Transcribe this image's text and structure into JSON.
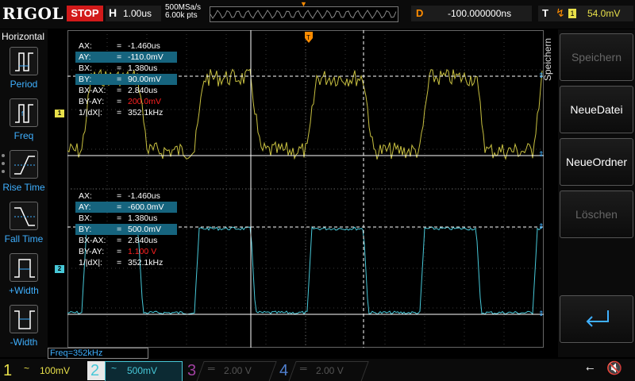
{
  "topbar": {
    "logo": "RIGOL",
    "run_state": "STOP",
    "timebase_key": "H",
    "timebase_value": "1.00us",
    "sample_rate": "500MSa/s",
    "memory_points": "6.00k pts",
    "delay_key": "D",
    "delay_value": "-100.000000ns",
    "trigger_key": "T",
    "trigger_source": "1",
    "trigger_level": "54.0mV"
  },
  "left_menu": {
    "title": "Horizontal",
    "items": [
      {
        "label": "Period",
        "icon": "period-icon"
      },
      {
        "label": "Freq",
        "icon": "freq-icon"
      },
      {
        "label": "Rise Time",
        "icon": "rise-time-icon"
      },
      {
        "label": "Fall Time",
        "icon": "fall-time-icon"
      },
      {
        "label": "+Width",
        "icon": "plus-width-icon"
      },
      {
        "label": "-Width",
        "icon": "minus-width-icon"
      }
    ]
  },
  "cursor_ch1": {
    "rows": [
      {
        "k": "AX:",
        "v": "-1.460us"
      },
      {
        "k": "AY:",
        "v": "-110.0mV"
      },
      {
        "k": "BX:",
        "v": "1.380us"
      },
      {
        "k": "BY:",
        "v": "90.00mV"
      },
      {
        "k": "BX-AX:",
        "v": "2.840us"
      },
      {
        "k": "BY-AY:",
        "v": "200.0mV"
      },
      {
        "k": "1/|dX|:",
        "v": "352.1kHz"
      }
    ]
  },
  "cursor_ch2": {
    "rows": [
      {
        "k": "AX:",
        "v": "-1.460us"
      },
      {
        "k": "AY:",
        "v": "-600.0mV"
      },
      {
        "k": "BX:",
        "v": "1.380us"
      },
      {
        "k": "BY:",
        "v": "500.0mV"
      },
      {
        "k": "BX-AX:",
        "v": "2.840us"
      },
      {
        "k": "BY-AY:",
        "v": "1.100 V"
      },
      {
        "k": "1/|dX|:",
        "v": "352.1kHz"
      }
    ]
  },
  "channel_markers": {
    "ch1": "1",
    "ch2": "2"
  },
  "freq_readout": "Freq=352kHz",
  "right_menu": {
    "vertical_label": "Speichern",
    "buttons": [
      {
        "label": "Speichern",
        "enabled": false
      },
      {
        "label": "NeueDatei",
        "enabled": true
      },
      {
        "label": "NeueOrdner",
        "enabled": true
      },
      {
        "label": "Löschen",
        "enabled": false
      }
    ],
    "enter_icon": "enter-return-icon"
  },
  "bottombar": {
    "channels": [
      {
        "num": "1",
        "coupling": "~",
        "scale": "100mV",
        "active": true
      },
      {
        "num": "2",
        "coupling": "~",
        "scale": "500mV",
        "active": true
      },
      {
        "num": "3",
        "coupling": "═",
        "scale": "2.00 V",
        "active": false
      },
      {
        "num": "4",
        "coupling": "═",
        "scale": "2.00 V",
        "active": false
      }
    ],
    "usb_icon": "usb-icon",
    "mute_icon": "mute-icon"
  },
  "colors": {
    "ch1": "#e8e04a",
    "ch2": "#47c8d8",
    "ch3": "#a040a0",
    "ch4": "#5080d0",
    "trigger": "#ff8c00",
    "stop": "#d21a1a",
    "highlight": "#16647e"
  }
}
